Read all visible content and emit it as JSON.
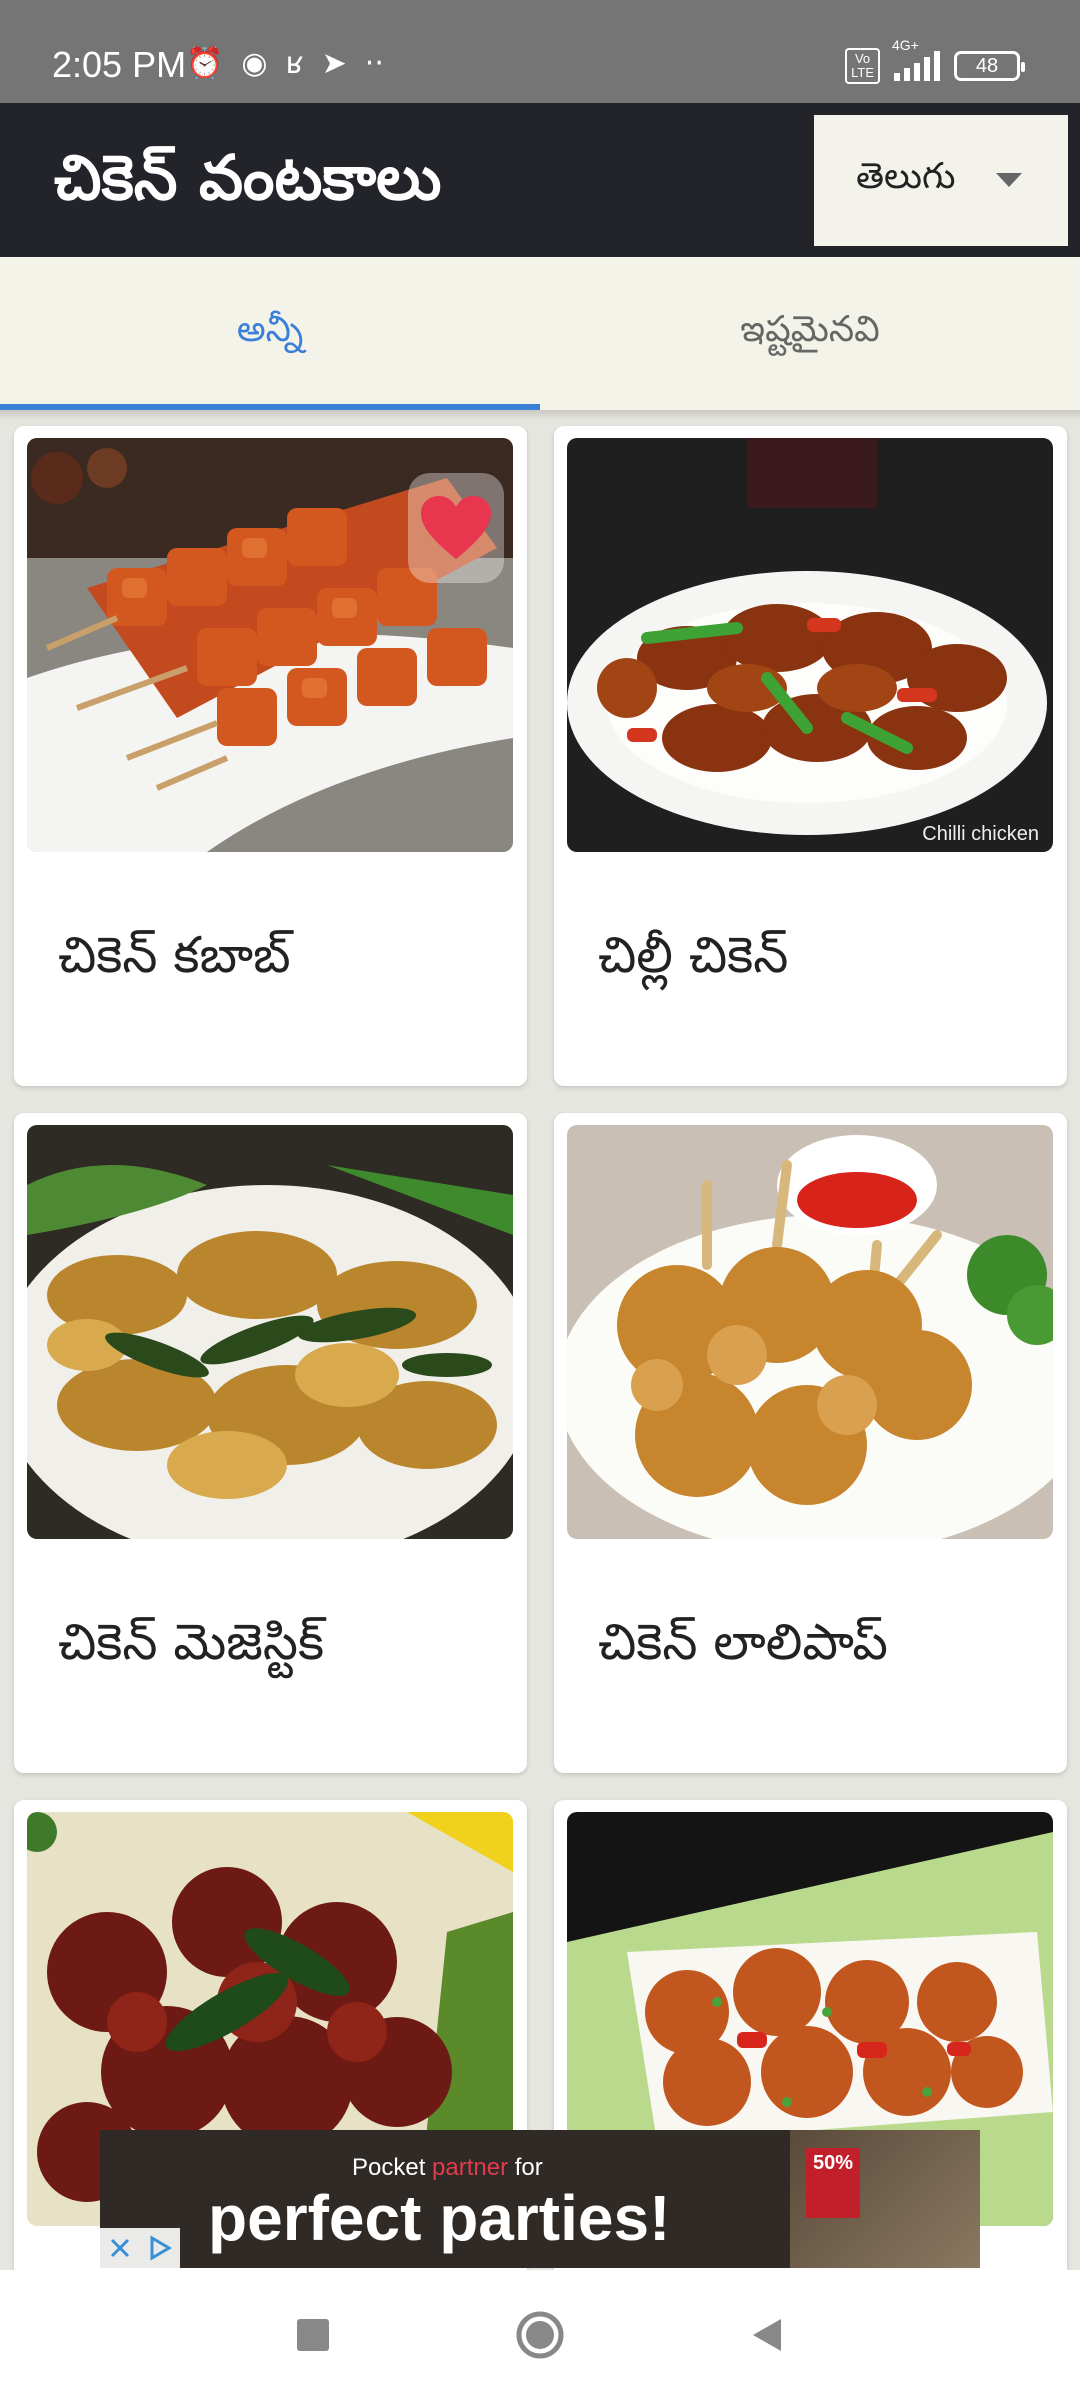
{
  "status_bar": {
    "time": "2:05 PM",
    "volte": "Vo\nLTE",
    "network": "4G+",
    "battery": "48",
    "more": "··"
  },
  "app_bar": {
    "title": "చికెన్ వంటకాలు",
    "language": "తెలుగు"
  },
  "tabs": [
    {
      "label": "అన్నీ",
      "active": true
    },
    {
      "label": "ఇష్టమైనవి",
      "active": false
    }
  ],
  "recipes": [
    {
      "title": "చికెన్ కబాబ్",
      "favorite": true
    },
    {
      "title": "చిల్లీ చికెన్",
      "caption": "Chilli chicken"
    },
    {
      "title": "చికెన్ మెజెస్టిక్"
    },
    {
      "title": "చికెన్ లాలిపాప్"
    },
    {
      "title": ""
    },
    {
      "title": ""
    }
  ],
  "ad": {
    "line1_a": "Pocket ",
    "line1_accent": "partner",
    "line1_b": " for",
    "line2": "perfect parties!",
    "sale": "50%"
  },
  "colors": {
    "accent": "#3c7fd6",
    "app_bar": "#22242a",
    "heart": "#e8364f"
  }
}
